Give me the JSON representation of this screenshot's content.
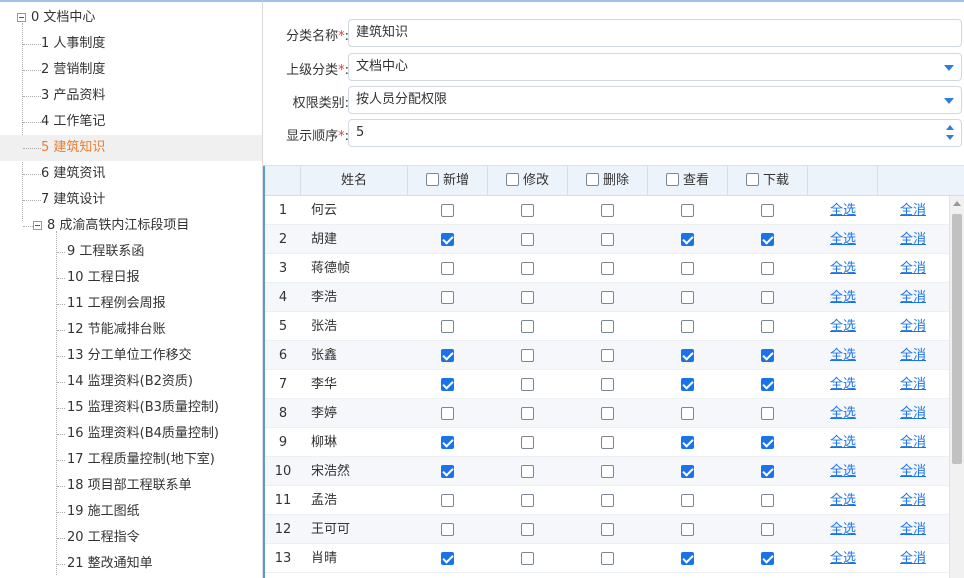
{
  "tree": {
    "root": {
      "label": "0 文档中心"
    },
    "items": [
      {
        "label": "1 人事制度"
      },
      {
        "label": "2 营销制度"
      },
      {
        "label": "3 产品资料"
      },
      {
        "label": "4 工作笔记"
      },
      {
        "label": "5 建筑知识",
        "selected": true
      },
      {
        "label": "6 建筑资讯"
      },
      {
        "label": "7 建筑设计"
      },
      {
        "label": "8 成渝高铁内江标段项目"
      }
    ],
    "children": [
      {
        "label": "9 工程联系函"
      },
      {
        "label": "10 工程日报"
      },
      {
        "label": "11 工程例会周报"
      },
      {
        "label": "12 节能减排台账"
      },
      {
        "label": "13 分工单位工作移交"
      },
      {
        "label": "14 监理资料(B2资质)"
      },
      {
        "label": "15 监理资料(B3质量控制)"
      },
      {
        "label": "16 监理资料(B4质量控制)"
      },
      {
        "label": "17 工程质量控制(地下室)"
      },
      {
        "label": "18 项目部工程联系单"
      },
      {
        "label": "19 施工图纸"
      },
      {
        "label": "20 工程指令"
      },
      {
        "label": "21 整改通知单"
      }
    ]
  },
  "form": {
    "name": {
      "label": "分类名称",
      "required_mark": "*",
      "colon": ":",
      "value": "建筑知识"
    },
    "parent": {
      "label": "上级分类",
      "required_mark": "*",
      "colon": ":",
      "value": "文档中心"
    },
    "perm": {
      "label": "权限类别",
      "colon": ":",
      "value": "按人员分配权限"
    },
    "order": {
      "label": "显示顺序",
      "required_mark": "*",
      "colon": ":",
      "value": "5"
    }
  },
  "table": {
    "headers": {
      "name": "姓名",
      "add": "新增",
      "edit": "修改",
      "del": "删除",
      "view": "查看",
      "download": "下载"
    },
    "select_all": "全选",
    "clear_all": "全消",
    "rows": [
      {
        "no": "1",
        "name": "何云",
        "perms": [
          false,
          false,
          false,
          false,
          false
        ]
      },
      {
        "no": "2",
        "name": "胡建",
        "perms": [
          true,
          false,
          false,
          true,
          true
        ]
      },
      {
        "no": "3",
        "name": "蒋德帧",
        "perms": [
          false,
          false,
          false,
          false,
          false
        ]
      },
      {
        "no": "4",
        "name": "李浩",
        "perms": [
          false,
          false,
          false,
          false,
          false
        ]
      },
      {
        "no": "5",
        "name": "张浩",
        "perms": [
          false,
          false,
          false,
          false,
          false
        ]
      },
      {
        "no": "6",
        "name": "张鑫",
        "perms": [
          true,
          false,
          false,
          true,
          true
        ]
      },
      {
        "no": "7",
        "name": "李华",
        "perms": [
          true,
          false,
          false,
          true,
          true
        ]
      },
      {
        "no": "8",
        "name": "李婷",
        "perms": [
          false,
          false,
          false,
          false,
          false
        ]
      },
      {
        "no": "9",
        "name": "柳琳",
        "perms": [
          true,
          false,
          false,
          true,
          true
        ]
      },
      {
        "no": "10",
        "name": "宋浩然",
        "perms": [
          true,
          false,
          false,
          true,
          true
        ]
      },
      {
        "no": "11",
        "name": "孟浩",
        "perms": [
          false,
          false,
          false,
          false,
          false
        ]
      },
      {
        "no": "12",
        "name": "王可可",
        "perms": [
          false,
          false,
          false,
          false,
          false
        ]
      },
      {
        "no": "13",
        "name": "肖晴",
        "perms": [
          true,
          false,
          false,
          true,
          true
        ]
      }
    ]
  },
  "colors": {
    "accent": "#1a73e8",
    "selected_text": "#f07c2a",
    "required": "#e53935",
    "header_bg": "#edf3fa",
    "alt_row": "#f5f7fa"
  }
}
